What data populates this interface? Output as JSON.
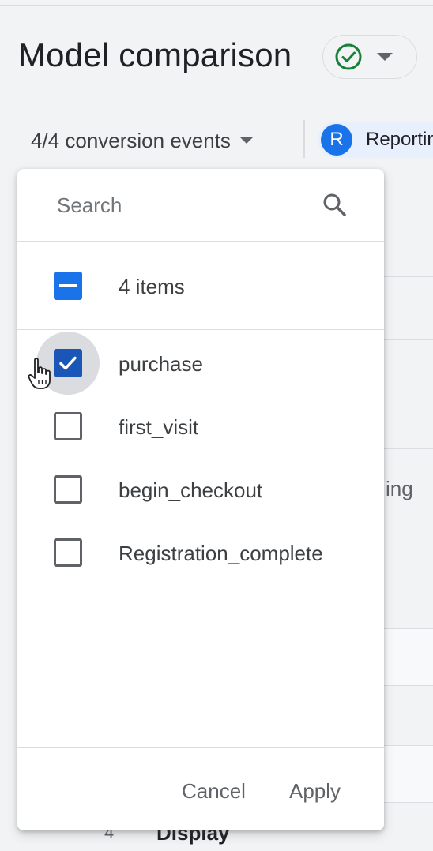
{
  "header": {
    "title": "Model comparison",
    "status_icon": "check-circle-icon",
    "status_color": "#188038"
  },
  "toolbar": {
    "events_dropdown_label": "4/4 conversion events",
    "reporting_avatar_letter": "R",
    "reporting_chip_label": "Reporting"
  },
  "background": {
    "partial_text": "ing",
    "row_number": "4",
    "row_label": "Display"
  },
  "dropdown": {
    "search": {
      "placeholder": "Search",
      "value": ""
    },
    "select_all": {
      "label": "4 items",
      "state": "indeterminate"
    },
    "items": [
      {
        "label": "purchase",
        "checked": true
      },
      {
        "label": "first_visit",
        "checked": false
      },
      {
        "label": "begin_checkout",
        "checked": false
      },
      {
        "label": "Registration_complete",
        "checked": false
      }
    ],
    "cancel_label": "Cancel",
    "apply_label": "Apply"
  },
  "colors": {
    "accent": "#1a73e8",
    "checked_fill": "#1a56b8",
    "chip_bg": "#e8f0fe",
    "page_bg": "#f1f3f4"
  }
}
